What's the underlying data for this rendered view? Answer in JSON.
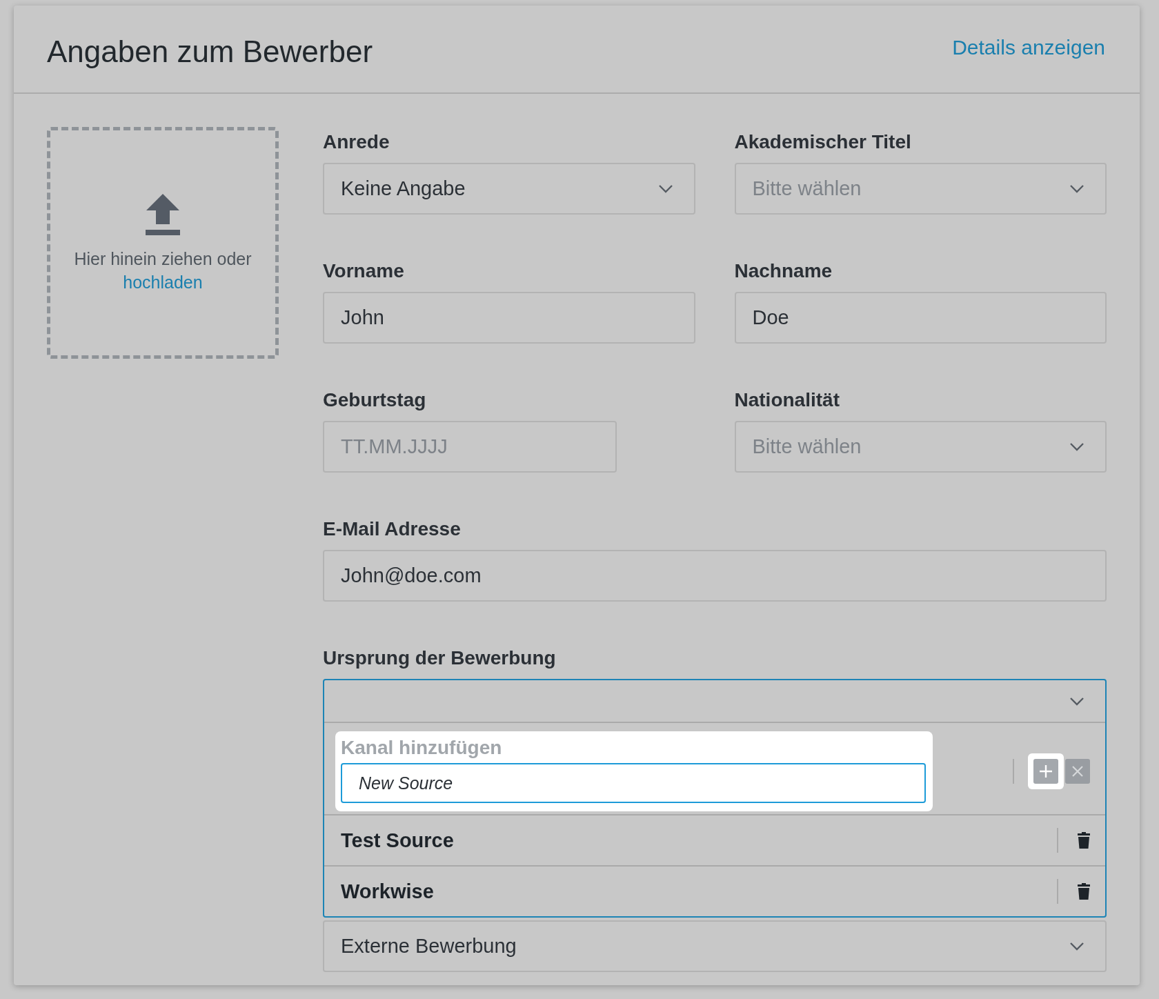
{
  "header": {
    "title": "Angaben zum Bewerber",
    "link": "Details anzeigen"
  },
  "upload": {
    "text": "Hier hinein ziehen oder",
    "link": "hochladen"
  },
  "rows": [
    [
      {
        "kind": "select",
        "label": "Anrede",
        "value": "Keine Angabe"
      },
      {
        "kind": "select",
        "label": "Akademischer Titel",
        "placeholder": "Bitte wählen"
      }
    ],
    [
      {
        "kind": "input",
        "label": "Vorname",
        "value": "John"
      },
      {
        "kind": "input",
        "label": "Nachname",
        "value": "Doe"
      }
    ],
    [
      {
        "kind": "date",
        "label": "Geburtstag",
        "placeholder": "TT.MM.JJJJ"
      },
      {
        "kind": "select",
        "label": "Nationalität",
        "placeholder": "Bitte wählen"
      }
    ],
    [
      {
        "kind": "input",
        "label": "E-Mail Adresse",
        "value": "John@doe.com"
      }
    ],
    [
      {
        "kind": "combobox",
        "label": "Ursprung der Bewerbung",
        "expanded": true,
        "new_channel": {
          "label": "Kanal hinzufügen",
          "value": "New Source"
        },
        "options": [
          {
            "label": "Test Source"
          },
          {
            "label": "Workwise"
          }
        ]
      }
    ],
    [
      {
        "kind": "select",
        "value": "Externe Bewerbung"
      }
    ]
  ]
}
